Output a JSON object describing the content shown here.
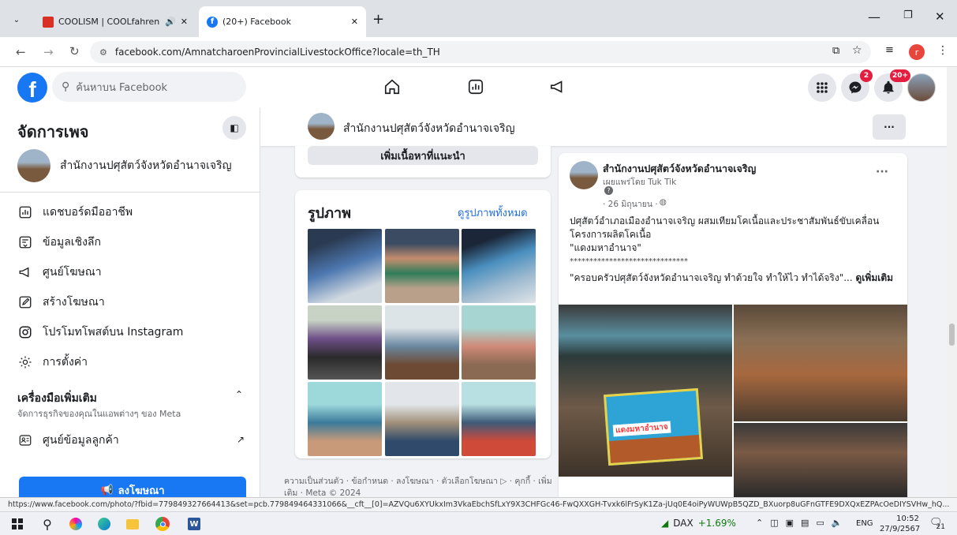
{
  "browser": {
    "tabs": [
      {
        "title": "COOLISM | COOLfahrenheit"
      },
      {
        "title": "(20+) Facebook"
      }
    ],
    "url": "facebook.com/AmnatcharoenProvincialLivestockOffice?locale=th_TH",
    "profile_initial": "r"
  },
  "fb": {
    "search_placeholder": "ค้นหาบน Facebook",
    "messenger_badge": "2",
    "notif_badge": "20+"
  },
  "sidebar": {
    "title": "จัดการเพจ",
    "page_name": "สำนักงานปศุสัตว์จังหวัดอำนาจเจริญ",
    "items": [
      {
        "label": "แดชบอร์ดมืออาชีพ"
      },
      {
        "label": "ข้อมูลเชิงลึก"
      },
      {
        "label": "ศูนย์โฆษณา"
      },
      {
        "label": "สร้างโฆษณา"
      },
      {
        "label": "โปรโมทโพสต์บน Instagram"
      },
      {
        "label": "การตั้งค่า"
      }
    ],
    "tools_title": "เครื่องมือเพิ่มเติม",
    "tools_subtitle": "จัดการธุรกิจของคุณในแอพต่างๆ ของ Meta",
    "tools_item": "ศูนย์ข้อมูลลูกค้า",
    "ads_button": "ลงโฆษณา"
  },
  "page_header": {
    "name": "สำนักงานปศุสัตว์จังหวัดอำนาจเจริญ",
    "more": "···"
  },
  "photos_card": {
    "top_button": "เพิ่มเนื้อหาที่แนะนำ",
    "title": "รูปภาพ",
    "see_all": "ดูรูปภาพทั้งหมด",
    "footer": "ความเป็นส่วนตัว · ข้อกำหนด · ลงโฆษณา · ตัวเลือกโฆษณา ▷ · คุกกี้ · เพิ่มเติม · Meta © 2024"
  },
  "post": {
    "author": "สำนักงานปศุสัตว์จังหวัดอำนาจเจริญ",
    "published_by": "เผยแพร่โดย Tuk Tik",
    "date": "· 26 มิถุนายน · ",
    "text1": "ปศุสัตว์อำเภอเมืองอำนาจเจริญ ผสมเทียมโคเนื้อและประชาสัมพันธ์ขับเคลื่อนโครงการผลิตโคเนื้อ",
    "text2": "\"แดงมหาอำนาจ\"",
    "text3": "******************************",
    "text4": "\"ครอบครัวปศุสัตว์จังหวัดอำนาจเจริญ ทำด้วยใจ ทำให้ไว ทำได้จริง\"...",
    "see_more": "ดูเพิ่มเติม",
    "banner_text": "แดงมหาอำนาจ"
  },
  "status_url": "https://www.facebook.com/photo/?fbid=779849327664413&set=pcb.779849464331066&__cft__[0]=AZVQu6XYUkxIm3VkaEbchSfLxY9X3CHFGc46-FwQXXGH-Tvxk6lFrSyK1Za-jUq0E4oiPyWUWpB5QZD_BXuorp8uGFnGTFE9DXQxEZPAcOeDIYSVHw_hQ...",
  "taskbar": {
    "stock_name": "DAX",
    "stock_change": "+1.69%",
    "lang": "ENG",
    "time": "10:52",
    "date": "27/9/2567",
    "notif_count": "21"
  },
  "colors": {
    "fb_blue": "#1877f2",
    "link_blue": "#216fdb",
    "stock_green": "#0e7a0d"
  }
}
